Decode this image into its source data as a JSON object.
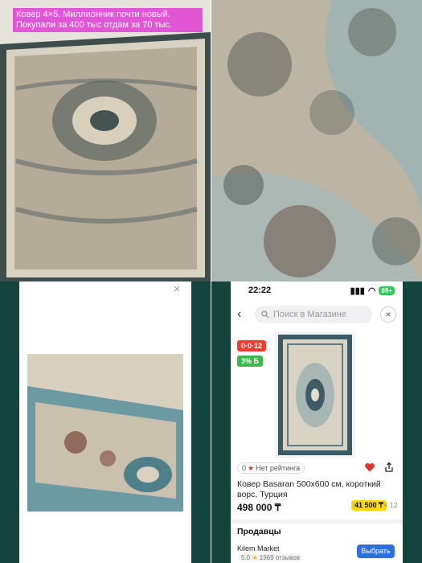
{
  "listing": {
    "caption": "Ковер 4×5. Миллионник почти новый. Покупали за 400 тыс отдам за 70 тыс."
  },
  "viewer": {
    "close_glyph": "×"
  },
  "phone": {
    "status": {
      "time": "22:22",
      "battery": "89+"
    },
    "search": {
      "back_glyph": "‹",
      "placeholder": "Поиск в Магазине",
      "close_glyph": "×"
    },
    "product": {
      "installment_badge": "0·0·12",
      "cashback_badge": "3% Б",
      "rating_count": "0",
      "rating_text": "Нет рейтинга",
      "title": "Ковер Basaran 500x600 см, короткий ворс, Турция",
      "price": "498 000 ₸",
      "installment_price": "41 500 ₸",
      "installment_months": "× 12"
    },
    "sellers": {
      "heading": "Продавцы",
      "seller_name": "Kilem Market",
      "seller_score": "5.0",
      "seller_reviews": "1969 отзывов",
      "choose_label": "Выбрать"
    }
  },
  "colors": {
    "accent": "#2e6fe0",
    "badge_red": "#f23d2e",
    "badge_green": "#3bb84a",
    "caption_bg": "#e14bd6",
    "frame": "#13443d"
  }
}
